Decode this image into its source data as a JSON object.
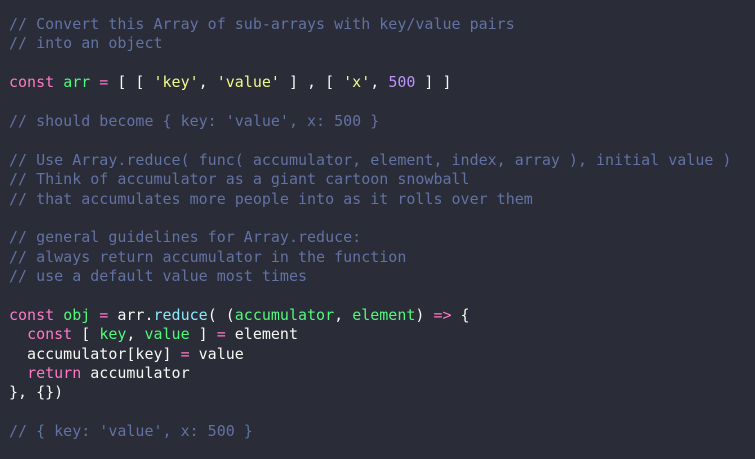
{
  "theme": {
    "background": "#2a2c37",
    "comment": "#6272a4",
    "keyword": "#ff79c6",
    "variable": "#50fa7b",
    "string": "#f1fa8c",
    "number": "#bd93f9",
    "method": "#8be9fd",
    "text": "#f8f8f2"
  },
  "code": {
    "lines": [
      [
        {
          "t": "comment",
          "v": "// Convert this Array of sub-arrays with key/value pairs"
        }
      ],
      [
        {
          "t": "comment",
          "v": "// into an object"
        }
      ],
      [],
      [
        {
          "t": "keyword",
          "v": "const "
        },
        {
          "t": "var",
          "v": "arr"
        },
        {
          "t": "op",
          "v": " = "
        },
        {
          "t": "punc",
          "v": "[ [ "
        },
        {
          "t": "string",
          "v": "'key'"
        },
        {
          "t": "punc",
          "v": ", "
        },
        {
          "t": "string",
          "v": "'value'"
        },
        {
          "t": "punc",
          "v": " ] , [ "
        },
        {
          "t": "string",
          "v": "'x'"
        },
        {
          "t": "punc",
          "v": ", "
        },
        {
          "t": "number",
          "v": "500"
        },
        {
          "t": "punc",
          "v": " ] ]"
        }
      ],
      [],
      [
        {
          "t": "comment",
          "v": "// should become { key: 'value', x: 500 }"
        }
      ],
      [],
      [
        {
          "t": "comment",
          "v": "// Use Array.reduce( func( accumulator, element, index, array ), initial value )"
        }
      ],
      [
        {
          "t": "comment",
          "v": "// Think of accumulator as a giant cartoon snowball"
        }
      ],
      [
        {
          "t": "comment",
          "v": "// that accumulates more people into as it rolls over them"
        }
      ],
      [],
      [
        {
          "t": "comment",
          "v": "// general guidelines for Array.reduce:"
        }
      ],
      [
        {
          "t": "comment",
          "v": "// always return accumulator in the function"
        }
      ],
      [
        {
          "t": "comment",
          "v": "// use a default value most times"
        }
      ],
      [],
      [
        {
          "t": "keyword",
          "v": "const "
        },
        {
          "t": "var",
          "v": "obj"
        },
        {
          "t": "op",
          "v": " = "
        },
        {
          "t": "plain",
          "v": "arr."
        },
        {
          "t": "method",
          "v": "reduce"
        },
        {
          "t": "punc",
          "v": "( ("
        },
        {
          "t": "param",
          "v": "accumulator"
        },
        {
          "t": "punc",
          "v": ", "
        },
        {
          "t": "param",
          "v": "element"
        },
        {
          "t": "punc",
          "v": ") "
        },
        {
          "t": "op",
          "v": "=>"
        },
        {
          "t": "punc",
          "v": " {"
        }
      ],
      [
        {
          "t": "plain",
          "v": "  "
        },
        {
          "t": "keyword",
          "v": "const "
        },
        {
          "t": "punc",
          "v": "[ "
        },
        {
          "t": "var",
          "v": "key"
        },
        {
          "t": "punc",
          "v": ", "
        },
        {
          "t": "var",
          "v": "value"
        },
        {
          "t": "punc",
          "v": " ] "
        },
        {
          "t": "op",
          "v": "="
        },
        {
          "t": "plain",
          "v": " element"
        }
      ],
      [
        {
          "t": "plain",
          "v": "  accumulator[key] "
        },
        {
          "t": "op",
          "v": "="
        },
        {
          "t": "plain",
          "v": " value"
        }
      ],
      [
        {
          "t": "plain",
          "v": "  "
        },
        {
          "t": "keyword",
          "v": "return"
        },
        {
          "t": "plain",
          "v": " accumulator"
        }
      ],
      [
        {
          "t": "punc",
          "v": "}, {})"
        }
      ],
      [],
      [
        {
          "t": "comment",
          "v": "// { key: 'value', x: 500 }"
        }
      ]
    ]
  }
}
